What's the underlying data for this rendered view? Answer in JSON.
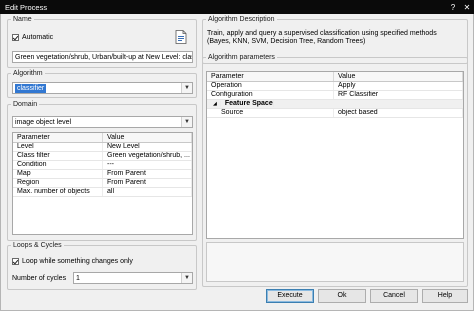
{
  "window": {
    "title": "Edit Process",
    "help_button": "?",
    "close_button": "✕"
  },
  "name_group": {
    "legend": "Name",
    "automatic_label": "Automatic",
    "automatic_checked": true,
    "name_value": "Green vegetation/shrub, Urban/built-up at  New Level: classifier"
  },
  "algorithm_group": {
    "legend": "Algorithm",
    "selected": "classifier"
  },
  "domain_group": {
    "legend": "Domain",
    "selected": "image object level",
    "table": {
      "columns": [
        "Parameter",
        "Value"
      ],
      "rows": [
        [
          "Level",
          "New Level"
        ],
        [
          "Class filter",
          "Green vegetation/shrub, ..."
        ],
        [
          "Condition",
          "---"
        ],
        [
          "Map",
          "From Parent"
        ],
        [
          "Region",
          "From Parent"
        ],
        [
          "Max. number of objects",
          "all"
        ]
      ]
    }
  },
  "loops_group": {
    "legend": "Loops & Cycles",
    "loop_label": "Loop while something changes only",
    "loop_checked": true,
    "cycles_label": "Number of cycles",
    "cycles_value": "1"
  },
  "algorithm_description": {
    "legend": "Algorithm Description",
    "text": "Train, apply and query a supervised classification using specified methods (Bayes, KNN, SVM, Decision Tree, Random Trees)"
  },
  "algorithm_parameters": {
    "legend": "Algorithm parameters",
    "columns": [
      "Parameter",
      "Value"
    ],
    "rows": [
      {
        "type": "param",
        "name": "Operation",
        "value": "Apply"
      },
      {
        "type": "param",
        "name": "Configuration",
        "value": "RF Classifier"
      },
      {
        "type": "category",
        "name": "Feature Space",
        "value": ""
      },
      {
        "type": "param",
        "name": "Source",
        "value": "object based"
      }
    ]
  },
  "buttons": {
    "execute": "Execute",
    "ok": "Ok",
    "cancel": "Cancel",
    "help": "Help"
  },
  "colors": {
    "titlebar": "#0a0a0a",
    "selection": "#3278d2"
  }
}
